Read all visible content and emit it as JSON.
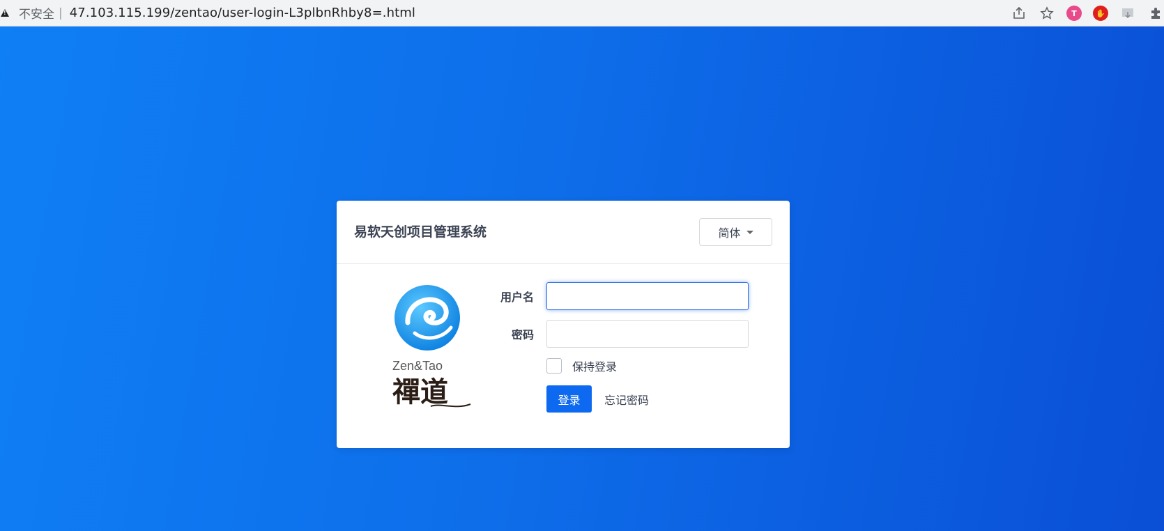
{
  "browser": {
    "security_label": "不安全",
    "separator": "|",
    "url": "47.103.115.199/zentao/user-login-L3plbnRhby8=.html"
  },
  "card": {
    "title": "易软天创项目管理系统",
    "language_button": "简体"
  },
  "logo": {
    "text": "Zen&Tao",
    "brand_cn": "禪道"
  },
  "form": {
    "username_label": "用户名",
    "username_value": "",
    "password_label": "密码",
    "password_value": "",
    "remember_label": "保持登录",
    "remember_checked": false,
    "login_button": "登录",
    "forgot_link": "忘记密码"
  },
  "colors": {
    "primary": "#0d6af0",
    "background_start": "#0f7ff5",
    "background_end": "#0a4fd6"
  }
}
